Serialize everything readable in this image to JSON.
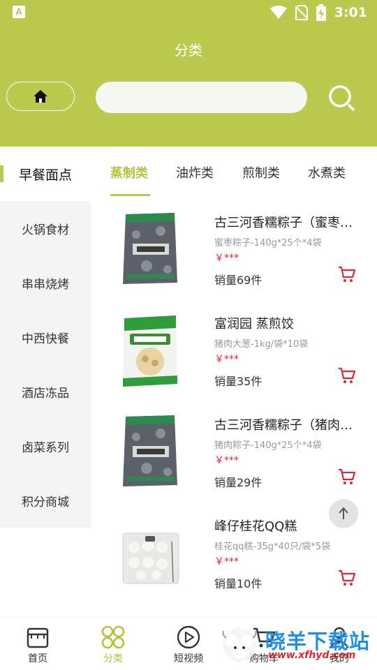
{
  "status_bar": {
    "time": "3:01",
    "app_badge": "A"
  },
  "header": {
    "title": "分类"
  },
  "search": {
    "placeholder": ""
  },
  "sidebar": {
    "items": [
      {
        "label": "早餐面点",
        "active": true
      },
      {
        "label": "火锅食材"
      },
      {
        "label": "串串烧烤"
      },
      {
        "label": "中西快餐"
      },
      {
        "label": "酒店冻品"
      },
      {
        "label": "卤菜系列"
      },
      {
        "label": "积分商城"
      }
    ]
  },
  "tabs": [
    {
      "label": "蒸制类",
      "active": true
    },
    {
      "label": "油炸类"
    },
    {
      "label": "煎制类"
    },
    {
      "label": "水煮类"
    }
  ],
  "products": [
    {
      "name": "古三河香糯粽子（蜜枣粽子）",
      "spec": "蜜枣粽子-140g*25个*4袋",
      "price": "￥***",
      "sales": "销量69件",
      "image": "zongzi-bag"
    },
    {
      "name": "富润园 蒸煎饺",
      "spec": "猪肉大葱-1kg/袋*10袋",
      "price": "￥***",
      "sales": "销量35件",
      "image": "dumpling-bag"
    },
    {
      "name": "古三河香糯粽子（猪肉粽子）",
      "spec": "猪肉粽子-140g*25个*4袋",
      "price": "￥***",
      "sales": "销量29件",
      "image": "zongzi-bag"
    },
    {
      "name": "峰仔桂花QQ糕",
      "spec": "桂花qq糕-35g*40只/袋*5袋",
      "price": "￥***",
      "sales": "销量10件",
      "image": "qq-cake-tray"
    }
  ],
  "bottom_nav": [
    {
      "label": "首页",
      "icon": "shop-icon"
    },
    {
      "label": "分类",
      "icon": "category-icon",
      "active": true
    },
    {
      "label": "短视频",
      "icon": "play-icon"
    },
    {
      "label": "购物车",
      "icon": "cart-icon"
    },
    {
      "label": "我的",
      "icon": "user-icon"
    }
  ],
  "watermark": {
    "title": "晓羊下载站",
    "url": "www.xfhyd.com"
  },
  "colors": {
    "accent": "#bcc94f",
    "accent_text": "#b5c23a",
    "price": "#e0262d",
    "cart": "#d8283a"
  }
}
